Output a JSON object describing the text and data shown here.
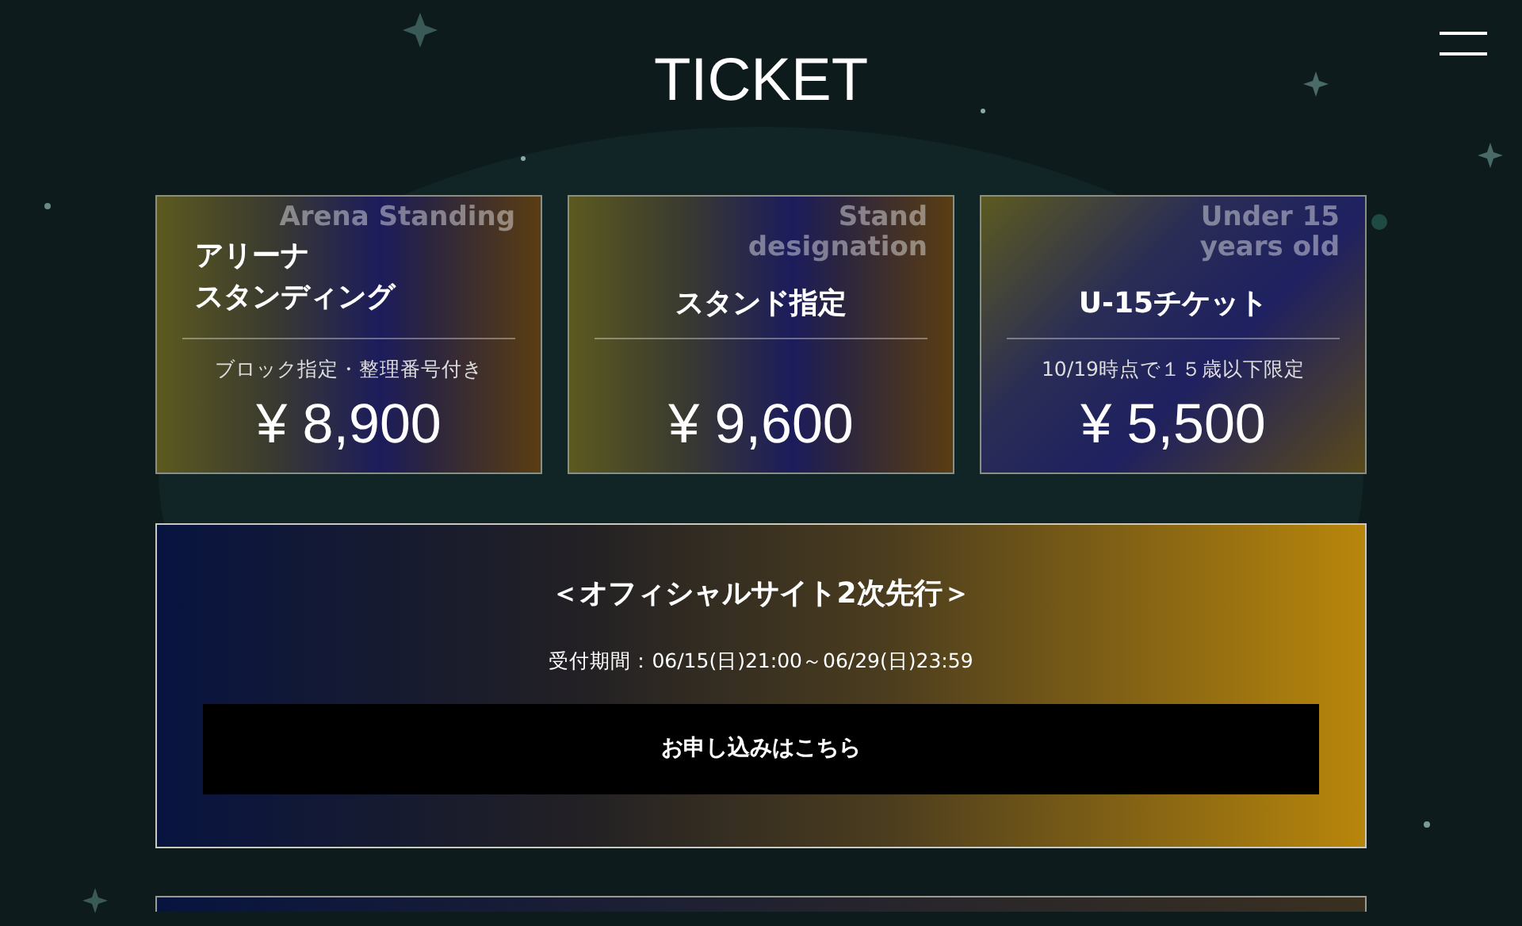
{
  "page_title": "TICKET",
  "tickets": [
    {
      "name_lines": [
        "アリーナ",
        "スタンディング"
      ],
      "bg_label_lines": [
        "Arena Standing"
      ],
      "note": "ブロック指定・整理番号付き",
      "price": "¥ 8,900"
    },
    {
      "name_lines": [
        "スタンド指定"
      ],
      "bg_label_lines": [
        "Stand",
        "designation"
      ],
      "price": "¥ 9,600"
    },
    {
      "name_lines": [
        "U-15チケット"
      ],
      "bg_label_lines": [
        "Under 15",
        "years old"
      ],
      "note": "10/19時点で１５歳以下限定",
      "price": "¥ 5,500"
    }
  ],
  "sales": [
    {
      "title": "＜オフィシャルサイト2次先行＞",
      "period": "受付期間：06/15(日)21:00～06/29(日)23:59",
      "button": "お申し込みはこちら"
    }
  ]
}
